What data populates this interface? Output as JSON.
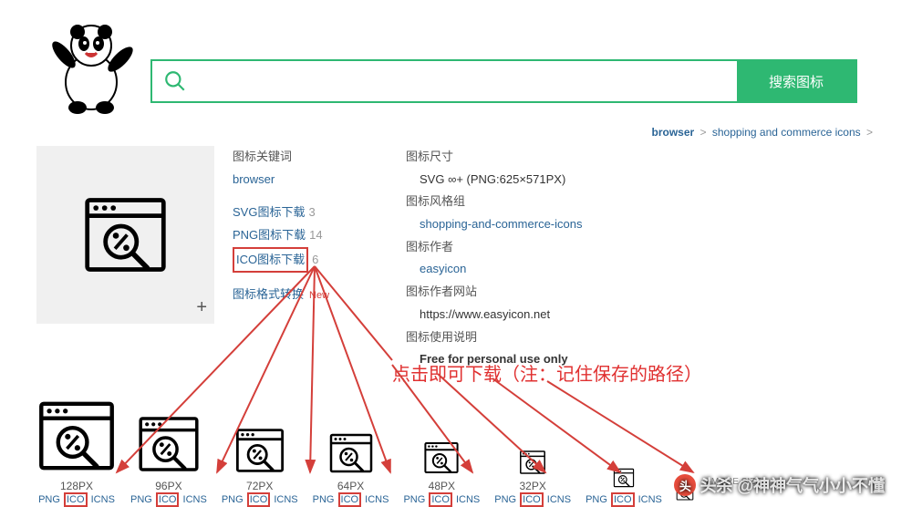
{
  "search": {
    "placeholder": "",
    "button": "搜索图标"
  },
  "breadcrumb": {
    "item1": "browser",
    "item2": "shopping and commerce icons"
  },
  "keywords_label": "图标关键词",
  "keywords_value": "browser",
  "downloads": {
    "svg": {
      "label": "SVG图标下载",
      "count": "3"
    },
    "png": {
      "label": "PNG图标下载",
      "count": "14"
    },
    "ico": {
      "label": "ICO图标下载",
      "count": "6"
    }
  },
  "convert": {
    "label": "图标格式转换",
    "badge": "New"
  },
  "meta": {
    "size_label": "图标尺寸",
    "size_value": "SVG ∞+ (PNG:625×571PX)",
    "style_label": "图标风格组",
    "style_value": "shopping-and-commerce-icons",
    "author_label": "图标作者",
    "author_value": "easyicon",
    "site_label": "图标作者网站",
    "site_value": "https://www.easyicon.net",
    "license_label": "图标使用说明",
    "license_value": "Free for personal use only"
  },
  "annotation": "点击即可下载（注：记住保存的路径）",
  "sizes": [
    {
      "px": "128PX",
      "f1": "PNG",
      "f2": "ICO",
      "f3": "ICNS",
      "dim": 88
    },
    {
      "px": "96PX",
      "f1": "PNG",
      "f2": "ICO",
      "f3": "ICNS",
      "dim": 70
    },
    {
      "px": "72PX",
      "f1": "PNG",
      "f2": "ICO",
      "f3": "ICNS",
      "dim": 56
    },
    {
      "px": "64PX",
      "f1": "PNG",
      "f2": "ICO",
      "f3": "ICNS",
      "dim": 50
    },
    {
      "px": "48PX",
      "f1": "PNG",
      "f2": "ICO",
      "f3": "ICNS",
      "dim": 40
    },
    {
      "px": "32PX",
      "f1": "PNG",
      "f2": "ICO",
      "f3": "ICNS",
      "dim": 30
    },
    {
      "px": "",
      "f1": "PNG",
      "f2": "ICO",
      "f3": "ICNS",
      "dim": 24
    },
    {
      "px": "",
      "f1": "",
      "f2": "",
      "f3": "",
      "dim": 20
    }
  ],
  "more_size": "▸MORE SIZE",
  "watermark": "头杀 @神神气气小小不懂"
}
